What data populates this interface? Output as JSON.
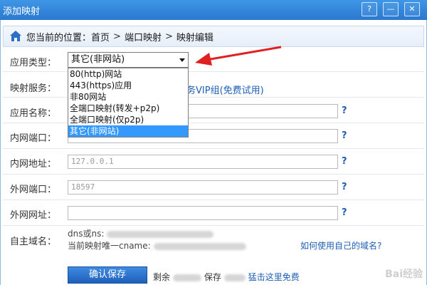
{
  "window": {
    "title": "添加映射",
    "buttons": [
      "?",
      "—",
      "✕"
    ]
  },
  "breadcrumb": {
    "prefix": "您当前的位置：",
    "items": [
      "首页",
      "端口映射",
      "映射编辑"
    ],
    "separator": ">"
  },
  "form": {
    "app_type": {
      "label": "应用类型：",
      "selected": "其它(非网站)",
      "options": [
        "80(http)网站",
        "443(https)应用",
        "非80网站",
        "全端口映射(转发+p2p)",
        "全端口映射(仅p2p)",
        "其它(非网站)"
      ]
    },
    "mapping_service": {
      "label": "映射服务：",
      "link_text": "务VIP组(免费试用)"
    },
    "app_name": {
      "label": "应用名称：",
      "value": ""
    },
    "lan_port": {
      "label": "内网端口：",
      "value": ""
    },
    "lan_address": {
      "label": "内网地址：",
      "value": "127.0.0.1"
    },
    "wan_port": {
      "label": "外网端口：",
      "value": "18597"
    },
    "wan_address": {
      "label": "外网网址：",
      "value": ""
    },
    "custom_domain": {
      "label": "自主域名：",
      "line1": "dns或ns:",
      "line2": "当前映射唯一cname:",
      "help_link": "如何使用自己的域名?"
    },
    "help": "?"
  },
  "footer": {
    "save_label": "确认保存",
    "remaining_text": "剩余",
    "save_text": "保存",
    "upgrade_link": "猛击这里免费",
    "watermark": "Bai经验"
  },
  "colors": {
    "titlebar": "#2a78cf",
    "link": "#1f5fb5",
    "selected_option": "#3399ff",
    "arrow": "#e02020"
  }
}
